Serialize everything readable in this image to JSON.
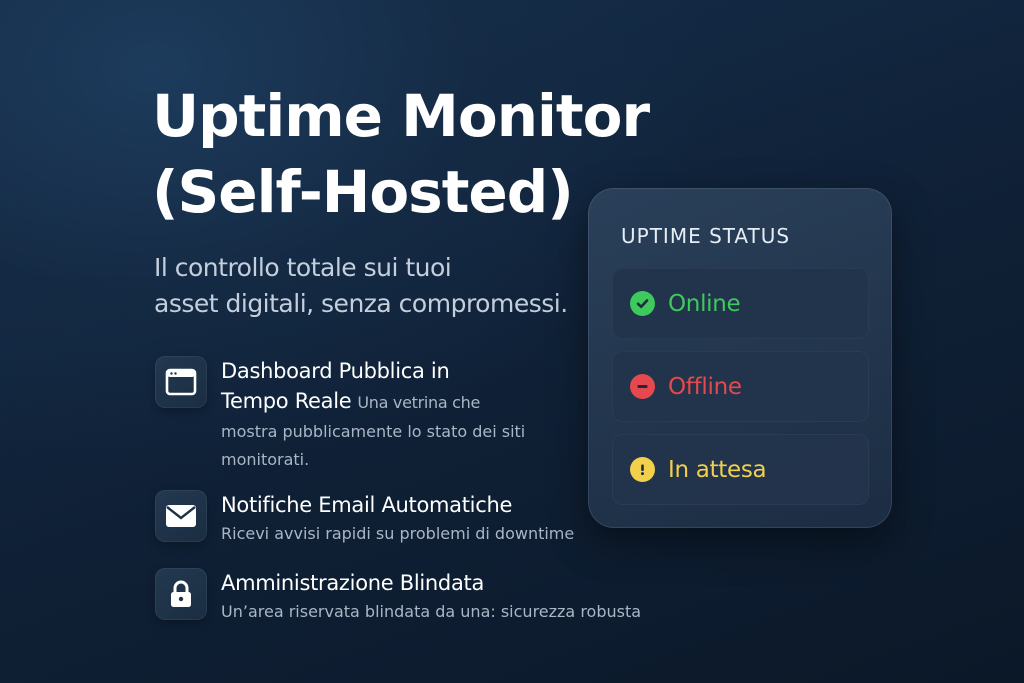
{
  "hero": {
    "title_line1": "Uptime Monitor",
    "title_line2": "(Self-Hosted)",
    "subtitle_line1": "Il controllo totale sui tuoi",
    "subtitle_line2": "asset digitali, senza compromessi."
  },
  "features": [
    {
      "icon": "browser-window-icon",
      "title_line1": "Dashboard Pubblica in",
      "title_line2": "Tempo Reale",
      "desc_inline": "Una vetrina che",
      "desc_line2": "mostra pubblicamente lo stato dei siti",
      "desc_line3": "monitorati."
    },
    {
      "icon": "envelope-icon",
      "title": "Notifiche Email Automatiche",
      "desc": "Ricevi avvisi rapidi su problemi di downtime"
    },
    {
      "icon": "lock-icon",
      "title": "Amministrazione Blindata",
      "desc": "Un’area riservata blindata da una: sicurezza robusta"
    }
  ],
  "status_panel": {
    "title": "UPTIME STATUS",
    "items": [
      {
        "label": "Online",
        "icon": "check-circle-icon",
        "color": "#3ec95c"
      },
      {
        "label": "Offline",
        "icon": "minus-circle-icon",
        "color": "#e5484d"
      },
      {
        "label": "In attesa",
        "icon": "exclamation-circle-icon",
        "color": "#f2d04b"
      }
    ]
  }
}
